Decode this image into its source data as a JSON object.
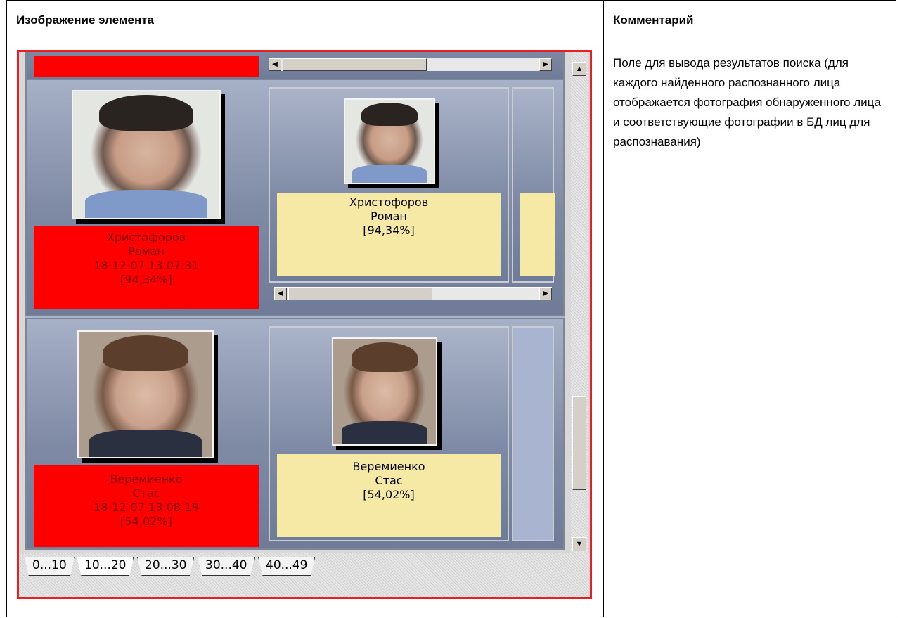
{
  "table": {
    "col_image_header": "Изображение элемента",
    "col_comment_header": "Комментарий",
    "comment": "Поле для вывода результатов поиска (для каждого найденного распознанного лица отображается фотография обнаруженного лица и соответствующие фотографии в БД лиц для распознавания)"
  },
  "results": [
    {
      "detected": {
        "name_line1": "Христофоров",
        "name_line2": "Роман",
        "timestamp": "18-12-07 13:07:31",
        "similarity": "[94,34%]"
      },
      "match": {
        "name_line1": "Христофоров",
        "name_line2": "Роман",
        "similarity": "[94,34%]"
      }
    },
    {
      "detected": {
        "name_line1": "Веремиенко",
        "name_line2": "Стас",
        "timestamp": "18-12-07 13:08:19",
        "similarity": "[54,02%]"
      },
      "match": {
        "name_line1": "Веремиенко",
        "name_line2": "Стас",
        "similarity": "[54,02%]"
      }
    }
  ],
  "tabs": [
    "0...10",
    "10...20",
    "20...30",
    "30...40",
    "40...49"
  ],
  "colors": {
    "panel_border": "#e62020",
    "detected_label_bg": "#ff0000",
    "match_label_bg": "#f6e9a5"
  }
}
